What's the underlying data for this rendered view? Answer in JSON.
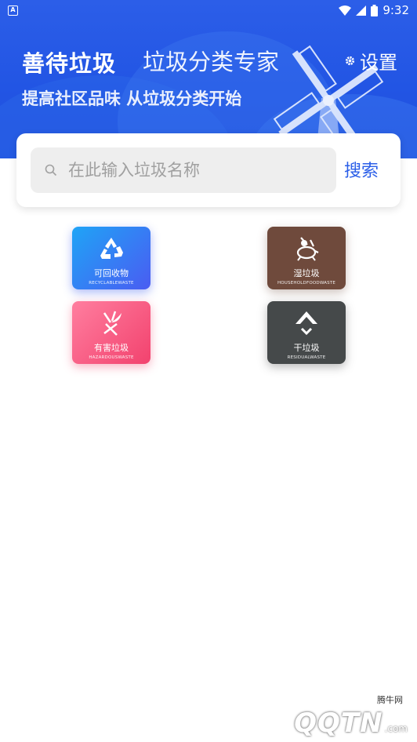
{
  "status_bar": {
    "time": "9:32",
    "app_icon": "A"
  },
  "header": {
    "title": "善待垃圾",
    "title_ghost": "垃圾分类专家",
    "subtitle": "提高社区品味 从垃圾分类开始",
    "settings_label": "设置"
  },
  "search": {
    "placeholder": "在此输入垃圾名称",
    "button_label": "搜索"
  },
  "categories": [
    {
      "name": "可回收物",
      "en": "RECYCLABLEWASTE",
      "icon": "recycle-icon",
      "color": "#2f86f4"
    },
    {
      "name": "湿垃圾",
      "en": "HOUSEHOLDFOODWASTE",
      "icon": "food-waste-icon",
      "color": "#6f4a3c"
    },
    {
      "name": "有害垃圾",
      "en": "HAZARDOUSWASTE",
      "icon": "hazardous-icon",
      "color": "#f45a7f"
    },
    {
      "name": "干垃圾",
      "en": "RESIDUALWASTE",
      "icon": "residual-icon",
      "color": "#45494a"
    }
  ],
  "watermark": {
    "logo": "QQTN",
    "suffix": ".com",
    "cn": "腾牛网"
  },
  "colors": {
    "primary": "#2255e4",
    "accent": "#2a5ee8"
  }
}
